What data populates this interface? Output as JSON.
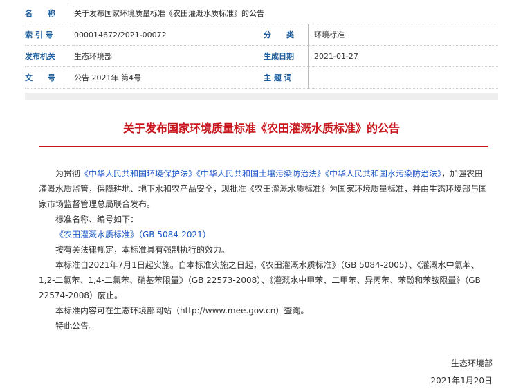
{
  "meta": {
    "name_label": "名　　称",
    "name_value": "关于发布国家环境质量标准《农田灌溉水质标准》的公告",
    "index_label": "索 引 号",
    "index_value": "000014672/2021-00072",
    "category_label": "分　　类",
    "category_value": "环境标准",
    "publisher_label": "发布机关",
    "publisher_value": "生态环境部",
    "date_label": "生成日期",
    "date_value": "2021-01-27",
    "docno_label": "文　　号",
    "docno_value": "公告 2021年 第4号",
    "subject_label": "主 题 词",
    "subject_value": ""
  },
  "title": "关于发布国家环境质量标准《农田灌溉水质标准》的公告",
  "body": {
    "p1_prefix": "为贯彻",
    "p1_law1": "《中华人民共和国环境保护法》",
    "p1_law2": "《中华人民共和国土壤污染防治法》",
    "p1_law3": "《中华人民共和国水污染防治法》",
    "p1_rest": "，加强农田灌溉水质监管，保障耕地、地下水和农产品安全，现批准《农田灌溉水质标准》为国家环境质量标准，并由生态环境部与国家市场监督管理总局联合发布。",
    "p2": "标准名称、编号如下：",
    "p3_link": "《农田灌溉水质标准》（GB 5084-2021）",
    "p4": "按有关法律规定，本标准具有强制执行的效力。",
    "p5": "本标准自2021年7月1日起实施。自本标准实施之日起，《农田灌溉水质标准》（GB 5084-2005）、《灌溉水中氯苯、1,2-二氯苯、1,4-二氯苯、硝基苯限量》（GB 22573-2008）、《灌溉水中甲苯、二甲苯、异丙苯、苯酚和苯胺限量》（GB 22574-2008）废止。",
    "p6": "本标准内容可在生态环境部网站（http://www.mee.gov.cn）查询。",
    "p7": "特此公告。"
  },
  "signature": {
    "org": "生态环境部",
    "date": "2021年1月20日"
  }
}
